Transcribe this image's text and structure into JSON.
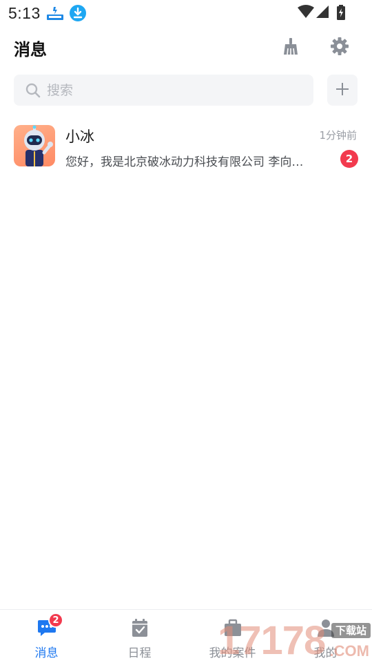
{
  "status_bar": {
    "time": "5:13",
    "icons": [
      "app-notification-icon",
      "download-icon",
      "wifi-icon",
      "signal-icon",
      "battery-charging-icon"
    ]
  },
  "header": {
    "title": "消息",
    "buttons": [
      "broom-clear-icon",
      "gear-icon"
    ]
  },
  "search": {
    "placeholder": "搜索",
    "value": ""
  },
  "conversations": [
    {
      "name": "小冰",
      "time": "1分钟前",
      "preview": "您好，我是北京破冰动力科技有限公司 李向…",
      "unread": "2",
      "avatar": "robot-avatar"
    }
  ],
  "bottom_nav": {
    "tabs": [
      {
        "label": "消息",
        "icon": "chat-bubble-icon",
        "active": true,
        "badge": "2"
      },
      {
        "label": "日程",
        "icon": "calendar-check-icon",
        "active": false
      },
      {
        "label": "我的案件",
        "icon": "briefcase-icon",
        "active": false
      },
      {
        "label": "我的",
        "icon": "person-icon",
        "active": false
      }
    ]
  },
  "watermark": {
    "number": "17178",
    "tag": "下载站",
    "domain": ".COM"
  },
  "colors": {
    "accent": "#1e78f0",
    "badge": "#f23a4e",
    "search_bg": "#f4f5f7"
  }
}
